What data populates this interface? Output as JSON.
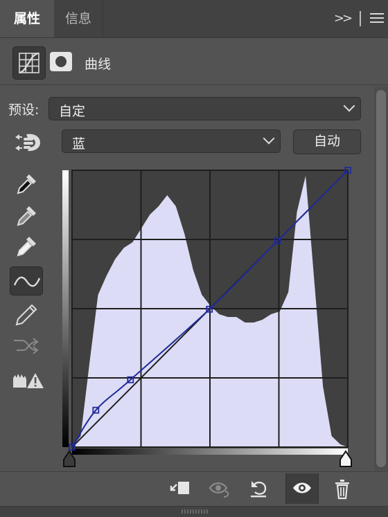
{
  "tabs": {
    "active_label": "属性",
    "info_label": "信息",
    "expand_label": ">>"
  },
  "header": {
    "title": "曲线",
    "adjustment_icon": "curves-adjustment-icon",
    "mask_icon": "layer-mask-icon"
  },
  "preset": {
    "label": "预设:",
    "value": "自定"
  },
  "channel": {
    "value": "蓝",
    "auto_label": "自动"
  },
  "tools": [
    "black-point-eyedropper-icon",
    "gray-point-eyedropper-icon",
    "white-point-eyedropper-icon",
    "curve-point-tool-icon",
    "pencil-draw-icon",
    "smooth-curve-icon",
    "clipping-warning-icon"
  ],
  "bottom_toolbar": [
    "clip-to-layer-icon",
    "view-previous-state-icon",
    "reset-icon",
    "visibility-eye-icon",
    "delete-trash-icon"
  ],
  "colors": {
    "histogram_fill": "#dcdcf6",
    "curve_color": "#1f2a9a",
    "graph_background": "#404040",
    "panel_background": "#535353"
  },
  "chart_data": {
    "type": "area",
    "channel": "蓝",
    "xlim": [
      0,
      255
    ],
    "ylim": [
      0,
      255
    ],
    "grid": "4x4",
    "control_points": [
      {
        "x": 0,
        "y": 0
      },
      {
        "x": 22,
        "y": 34
      },
      {
        "x": 54,
        "y": 62
      },
      {
        "x": 127,
        "y": 127
      },
      {
        "x": 190,
        "y": 190
      },
      {
        "x": 255,
        "y": 255
      }
    ],
    "histogram_x": [
      0,
      8,
      16,
      24,
      32,
      40,
      48,
      56,
      64,
      72,
      80,
      88,
      96,
      104,
      112,
      120,
      128,
      136,
      144,
      152,
      160,
      168,
      176,
      184,
      192,
      200,
      208,
      216,
      224,
      232,
      240,
      248,
      255
    ],
    "histogram_y": [
      0.0,
      0.04,
      0.3,
      0.55,
      0.62,
      0.68,
      0.72,
      0.74,
      0.79,
      0.84,
      0.87,
      0.91,
      0.87,
      0.77,
      0.64,
      0.55,
      0.51,
      0.48,
      0.47,
      0.47,
      0.45,
      0.45,
      0.46,
      0.48,
      0.49,
      0.56,
      0.85,
      0.98,
      0.6,
      0.22,
      0.04,
      0.01,
      0.0
    ]
  }
}
